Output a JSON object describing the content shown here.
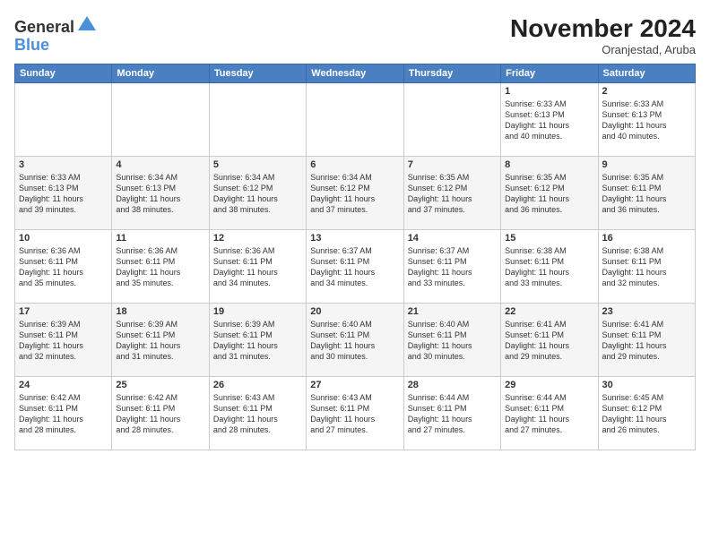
{
  "logo": {
    "general": "General",
    "blue": "Blue"
  },
  "header": {
    "month": "November 2024",
    "location": "Oranjestad, Aruba"
  },
  "days_of_week": [
    "Sunday",
    "Monday",
    "Tuesday",
    "Wednesday",
    "Thursday",
    "Friday",
    "Saturday"
  ],
  "weeks": [
    [
      {
        "day": "",
        "info": ""
      },
      {
        "day": "",
        "info": ""
      },
      {
        "day": "",
        "info": ""
      },
      {
        "day": "",
        "info": ""
      },
      {
        "day": "",
        "info": ""
      },
      {
        "day": "1",
        "info": "Sunrise: 6:33 AM\nSunset: 6:13 PM\nDaylight: 11 hours\nand 40 minutes."
      },
      {
        "day": "2",
        "info": "Sunrise: 6:33 AM\nSunset: 6:13 PM\nDaylight: 11 hours\nand 40 minutes."
      }
    ],
    [
      {
        "day": "3",
        "info": "Sunrise: 6:33 AM\nSunset: 6:13 PM\nDaylight: 11 hours\nand 39 minutes."
      },
      {
        "day": "4",
        "info": "Sunrise: 6:34 AM\nSunset: 6:13 PM\nDaylight: 11 hours\nand 38 minutes."
      },
      {
        "day": "5",
        "info": "Sunrise: 6:34 AM\nSunset: 6:12 PM\nDaylight: 11 hours\nand 38 minutes."
      },
      {
        "day": "6",
        "info": "Sunrise: 6:34 AM\nSunset: 6:12 PM\nDaylight: 11 hours\nand 37 minutes."
      },
      {
        "day": "7",
        "info": "Sunrise: 6:35 AM\nSunset: 6:12 PM\nDaylight: 11 hours\nand 37 minutes."
      },
      {
        "day": "8",
        "info": "Sunrise: 6:35 AM\nSunset: 6:12 PM\nDaylight: 11 hours\nand 36 minutes."
      },
      {
        "day": "9",
        "info": "Sunrise: 6:35 AM\nSunset: 6:11 PM\nDaylight: 11 hours\nand 36 minutes."
      }
    ],
    [
      {
        "day": "10",
        "info": "Sunrise: 6:36 AM\nSunset: 6:11 PM\nDaylight: 11 hours\nand 35 minutes."
      },
      {
        "day": "11",
        "info": "Sunrise: 6:36 AM\nSunset: 6:11 PM\nDaylight: 11 hours\nand 35 minutes."
      },
      {
        "day": "12",
        "info": "Sunrise: 6:36 AM\nSunset: 6:11 PM\nDaylight: 11 hours\nand 34 minutes."
      },
      {
        "day": "13",
        "info": "Sunrise: 6:37 AM\nSunset: 6:11 PM\nDaylight: 11 hours\nand 34 minutes."
      },
      {
        "day": "14",
        "info": "Sunrise: 6:37 AM\nSunset: 6:11 PM\nDaylight: 11 hours\nand 33 minutes."
      },
      {
        "day": "15",
        "info": "Sunrise: 6:38 AM\nSunset: 6:11 PM\nDaylight: 11 hours\nand 33 minutes."
      },
      {
        "day": "16",
        "info": "Sunrise: 6:38 AM\nSunset: 6:11 PM\nDaylight: 11 hours\nand 32 minutes."
      }
    ],
    [
      {
        "day": "17",
        "info": "Sunrise: 6:39 AM\nSunset: 6:11 PM\nDaylight: 11 hours\nand 32 minutes."
      },
      {
        "day": "18",
        "info": "Sunrise: 6:39 AM\nSunset: 6:11 PM\nDaylight: 11 hours\nand 31 minutes."
      },
      {
        "day": "19",
        "info": "Sunrise: 6:39 AM\nSunset: 6:11 PM\nDaylight: 11 hours\nand 31 minutes."
      },
      {
        "day": "20",
        "info": "Sunrise: 6:40 AM\nSunset: 6:11 PM\nDaylight: 11 hours\nand 30 minutes."
      },
      {
        "day": "21",
        "info": "Sunrise: 6:40 AM\nSunset: 6:11 PM\nDaylight: 11 hours\nand 30 minutes."
      },
      {
        "day": "22",
        "info": "Sunrise: 6:41 AM\nSunset: 6:11 PM\nDaylight: 11 hours\nand 29 minutes."
      },
      {
        "day": "23",
        "info": "Sunrise: 6:41 AM\nSunset: 6:11 PM\nDaylight: 11 hours\nand 29 minutes."
      }
    ],
    [
      {
        "day": "24",
        "info": "Sunrise: 6:42 AM\nSunset: 6:11 PM\nDaylight: 11 hours\nand 28 minutes."
      },
      {
        "day": "25",
        "info": "Sunrise: 6:42 AM\nSunset: 6:11 PM\nDaylight: 11 hours\nand 28 minutes."
      },
      {
        "day": "26",
        "info": "Sunrise: 6:43 AM\nSunset: 6:11 PM\nDaylight: 11 hours\nand 28 minutes."
      },
      {
        "day": "27",
        "info": "Sunrise: 6:43 AM\nSunset: 6:11 PM\nDaylight: 11 hours\nand 27 minutes."
      },
      {
        "day": "28",
        "info": "Sunrise: 6:44 AM\nSunset: 6:11 PM\nDaylight: 11 hours\nand 27 minutes."
      },
      {
        "day": "29",
        "info": "Sunrise: 6:44 AM\nSunset: 6:11 PM\nDaylight: 11 hours\nand 27 minutes."
      },
      {
        "day": "30",
        "info": "Sunrise: 6:45 AM\nSunset: 6:12 PM\nDaylight: 11 hours\nand 26 minutes."
      }
    ]
  ]
}
